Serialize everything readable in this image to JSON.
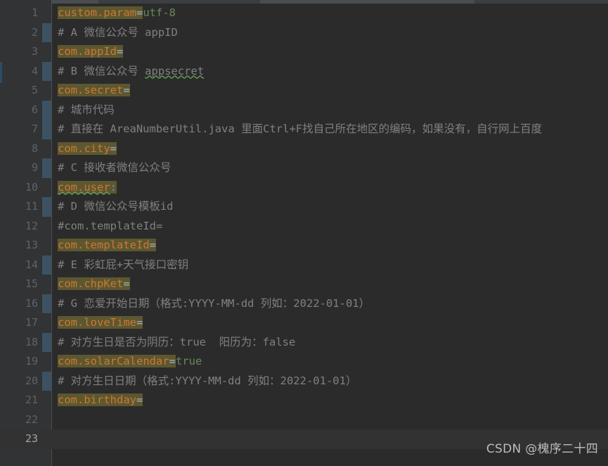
{
  "editor": {
    "file_type": "properties",
    "theme": "darcula",
    "colors": {
      "background": "#2b2b2b",
      "gutter_background": "#313335",
      "gutter_border": "#4b4e50",
      "line_number": "#606366",
      "line_number_active": "#a4a3a3",
      "caret_row_background": "#323232",
      "key_foreground": "#cc7832",
      "key_highlight_background": "#5c5730",
      "value_foreground": "#6a8759",
      "comment_foreground": "#808080",
      "separator_foreground": "#a9b7c6",
      "colon_foreground": "#6897bb",
      "vcs_change_marker": "#3c5263",
      "typo_squiggle": "#629755",
      "watermark_foreground": "#c8c8c8"
    },
    "total_lines": 23,
    "active_line": 23,
    "lines": [
      {
        "number": "1",
        "type": "property",
        "vcs_marker": false,
        "key": "custom.param",
        "separator": "=",
        "value": "utf-8",
        "key_squiggle": false
      },
      {
        "number": "2",
        "type": "comment",
        "vcs_marker": true,
        "text": "# A 微信公众号 appID"
      },
      {
        "number": "3",
        "type": "property",
        "vcs_marker": false,
        "key": "com.appId",
        "separator": "=",
        "value": "",
        "key_squiggle": false
      },
      {
        "number": "4",
        "type": "comment",
        "vcs_marker": true,
        "text": "# B 微信公众号 ",
        "typo": "appsecret"
      },
      {
        "number": "5",
        "type": "property",
        "vcs_marker": false,
        "key": "com.secret",
        "separator": "=",
        "value": "",
        "key_squiggle": false
      },
      {
        "number": "6",
        "type": "comment",
        "vcs_marker": true,
        "text": "# 城市代码"
      },
      {
        "number": "7",
        "type": "comment",
        "vcs_marker": true,
        "text": "# 直接在 AreaNumberUtil.java 里面Ctrl+F找自己所在地区的编码，如果没有，自行网上百度"
      },
      {
        "number": "8",
        "type": "property",
        "vcs_marker": false,
        "key": "com.city",
        "separator": "=",
        "value": "",
        "key_squiggle": false
      },
      {
        "number": "9",
        "type": "comment",
        "vcs_marker": true,
        "text": "# C 接收者微信公众号"
      },
      {
        "number": "10",
        "type": "property",
        "vcs_marker": false,
        "key": "com.user",
        "separator": ":",
        "value": "",
        "key_squiggle": true
      },
      {
        "number": "11",
        "type": "comment",
        "vcs_marker": true,
        "text": "# D 微信公众号模板id"
      },
      {
        "number": "12",
        "type": "comment",
        "vcs_marker": false,
        "text": "#com.templateId="
      },
      {
        "number": "13",
        "type": "property",
        "vcs_marker": false,
        "key": "com.templateId",
        "separator": "=",
        "value": "",
        "key_squiggle": false
      },
      {
        "number": "14",
        "type": "comment",
        "vcs_marker": true,
        "text": "# E 彩虹屁+天气接口密钥"
      },
      {
        "number": "15",
        "type": "property",
        "vcs_marker": false,
        "key": "com.chpKet",
        "separator": "=",
        "value": "",
        "key_squiggle": false
      },
      {
        "number": "16",
        "type": "comment",
        "vcs_marker": true,
        "text": "# G 恋爱开始日期（格式:YYYY-MM-dd 列如：2022-01-01）"
      },
      {
        "number": "17",
        "type": "property",
        "vcs_marker": false,
        "key": "com.loveTime",
        "separator": "=",
        "value": "",
        "key_squiggle": false
      },
      {
        "number": "18",
        "type": "comment",
        "vcs_marker": true,
        "text": "# 对方生日是否为阴历：true  阳历为：false"
      },
      {
        "number": "19",
        "type": "property",
        "vcs_marker": false,
        "key": "com.solarCalendar",
        "separator": "=",
        "value": "true",
        "key_squiggle": false
      },
      {
        "number": "20",
        "type": "comment",
        "vcs_marker": true,
        "text": "# 对方生日日期（格式:YYYY-MM-dd 列如：2022-01-01）"
      },
      {
        "number": "21",
        "type": "property",
        "vcs_marker": false,
        "key": "com.birthday",
        "separator": "=",
        "value": "",
        "key_squiggle": false
      },
      {
        "number": "22",
        "type": "blank",
        "vcs_marker": false,
        "text": ""
      },
      {
        "number": "23",
        "type": "blank",
        "vcs_marker": false,
        "text": ""
      }
    ]
  },
  "watermark": {
    "text": "CSDN @槐序二十四"
  }
}
